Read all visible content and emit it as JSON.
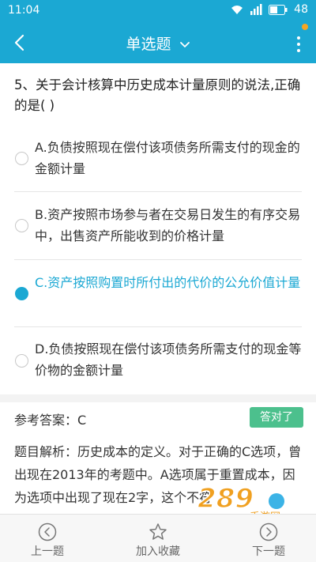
{
  "status": {
    "time": "11:04",
    "battery": "48"
  },
  "header": {
    "title": "单选题"
  },
  "question": {
    "text": "5、关于会计核算中历史成本计量原则的说法,正确的是( )"
  },
  "options": [
    {
      "text": "A.负债按照现在偿付该项债务所需支付的现金的金额计量",
      "selected": false
    },
    {
      "text": "B.资产按照市场参与者在交易日发生的有序交易中，出售资产所能收到的价格计量",
      "selected": false
    },
    {
      "text": "C.资产按照购置时所付出的代价的公允价值计量",
      "selected": true
    },
    {
      "text": "D.负债按照现在偿付该项债务所需支付的现金等价物的金额计量",
      "selected": false
    }
  ],
  "answer": {
    "label": "参考答案：C",
    "badge": "答对了"
  },
  "analysis": {
    "text": "题目解析：历史成本的定义。对于正确的C选项，曾出现在2013年的考题中。A选项属于重置成本，因为选项中出现了现在2字，这个不符"
  },
  "bottom_nav": [
    {
      "label": "上一题",
      "icon": "chevron-left-circle-icon"
    },
    {
      "label": "加入收藏",
      "icon": "star-icon"
    },
    {
      "label": "下一题",
      "icon": "chevron-right-circle-icon"
    }
  ],
  "watermark": {
    "text": "289",
    "subtext": "手游网"
  },
  "colors": {
    "accent": "#1ba8d3",
    "correct_badge": "#4cc08d",
    "menu_badge": "#f5a623"
  }
}
